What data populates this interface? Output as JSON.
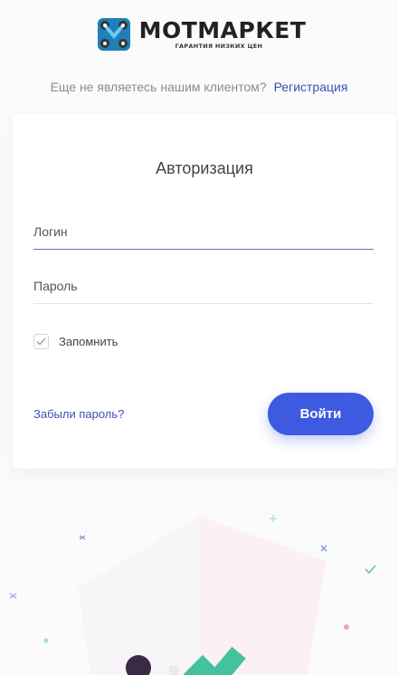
{
  "brand": {
    "name": "MOTМАРКЕТ",
    "tagline": "ГАРАНТИЯ НИЗКИХ ЦЕН",
    "colors": {
      "mark": "#2a8fc7",
      "text": "#222222"
    }
  },
  "signup": {
    "prompt": "Еще не являетесь нашим клиентом?",
    "link_label": "Регистрация"
  },
  "form": {
    "title": "Авторизация",
    "login_placeholder": "Логин",
    "password_placeholder": "Пароль",
    "remember_label": "Запомнить",
    "remember_checked": true,
    "forgot_label": "Забыли пароль?",
    "submit_label": "Войти"
  },
  "colors": {
    "accent": "#3d5ae0",
    "link": "#3f4fb5",
    "background": "#fbfbfc"
  },
  "decor": {
    "icons": [
      "plus-icon",
      "check-icon",
      "shield-icon",
      "person-icon"
    ]
  }
}
